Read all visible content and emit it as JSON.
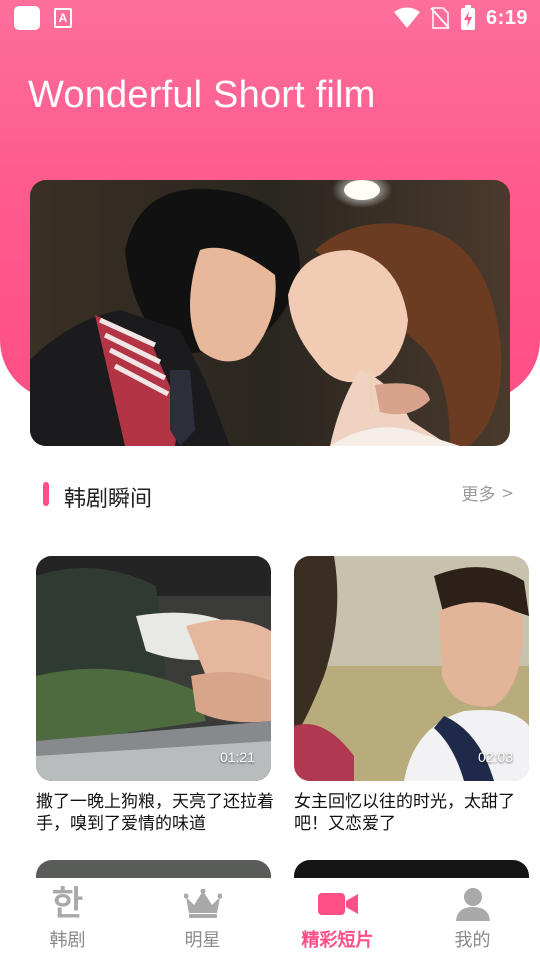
{
  "status_bar": {
    "time": "6:19",
    "icons": [
      "app-icon",
      "a-icon",
      "wifi-icon",
      "no-sim-icon",
      "battery-charging-icon"
    ]
  },
  "header": {
    "title": "Wonderful Short film"
  },
  "banner": {
    "image": "banner-drama-kiss-scene"
  },
  "section": {
    "title": "韩剧瞬间",
    "more_label": "更多",
    "more_chevron": ">"
  },
  "cards": [
    {
      "duration": "01:21",
      "title": "撒了一晚上狗粮，天亮了还拉着手，嗅到了爱情的味道",
      "image": "holding-hands"
    },
    {
      "duration": "02:03",
      "title": "女主回忆以往的时光，太甜了吧！又恋爱了",
      "image": "young-man-smiling"
    }
  ],
  "bottom_nav": {
    "items": [
      {
        "label": "韩剧",
        "icon": "han-character-icon",
        "glyph": "한",
        "active": false
      },
      {
        "label": "明星",
        "icon": "crown-icon",
        "active": false
      },
      {
        "label": "精彩短片",
        "icon": "video-camera-icon",
        "active": true
      },
      {
        "label": "我的",
        "icon": "person-icon",
        "active": false
      }
    ]
  },
  "colors": {
    "accent": "#ff4f86",
    "header_gradient_top": "#fd6f9b",
    "inactive_nav": "#a9a9a9",
    "more_text": "#9a9a9a"
  }
}
